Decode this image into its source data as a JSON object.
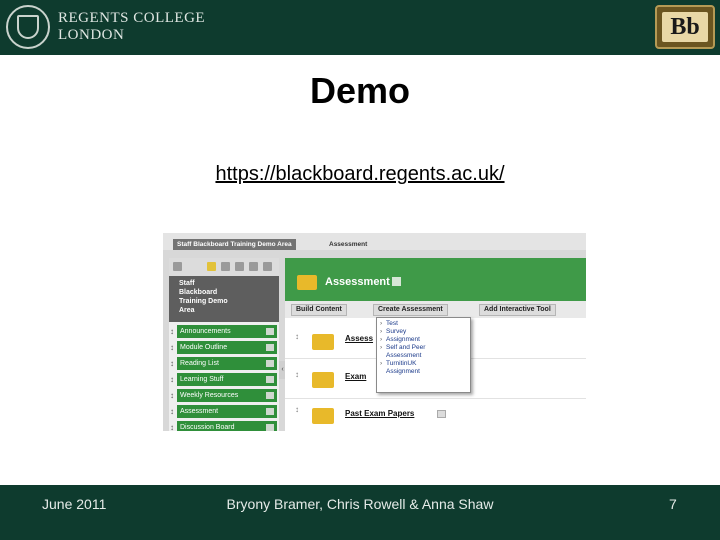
{
  "header": {
    "college_line1": "REGENTS COLLEGE",
    "college_line2": "LONDON",
    "bb_logo_text": "Bb",
    "brand_color": "#0e3b2e"
  },
  "slide": {
    "title": "Demo",
    "link": "https://blackboard.regents.ac.uk/"
  },
  "screenshot": {
    "tab_label": "Staff Blackboard Training Demo Area",
    "breadcrumb": "Assessment",
    "course_name": [
      "Staff",
      "Blackboard",
      "Training Demo",
      "Area"
    ],
    "sidebar_items": [
      "Announcements",
      "Module Outline",
      "Reading List",
      "Learning Stuff",
      "Weekly Resources",
      "Assessment",
      "Discussion Board"
    ],
    "page_title": "Assessment",
    "action_buttons": [
      "Build Content",
      "Create Assessment",
      "Add Interactive Tool"
    ],
    "menu_items": [
      "Test",
      "Survey",
      "Assignment",
      "Self and Peer",
      "Assessment",
      "TurnitinUK",
      "Assignment"
    ],
    "rows": [
      "Assess",
      "Exam",
      "Past Exam Papers"
    ],
    "accent_green": "#3f9a48",
    "icons": [
      "folder-icon",
      "drag-handle-icon",
      "caret-down-icon",
      "refresh-icon",
      "chevron-right-icon"
    ]
  },
  "footer": {
    "date": "June 2011",
    "authors": "Bryony Bramer, Chris Rowell & Anna Shaw",
    "page_number": "7"
  }
}
